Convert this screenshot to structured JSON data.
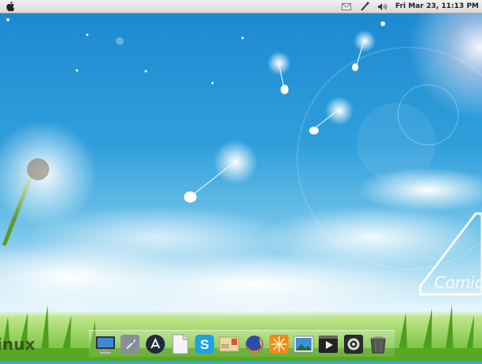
{
  "menubar": {
    "app_icon": "apple-logo-icon",
    "tray_icons": [
      "mail-icon",
      "network-icon",
      "volume-icon"
    ],
    "clock": "Fri Mar 23, 11:13 PM"
  },
  "desktop": {
    "partial_label_left": "inux",
    "partial_label_right": "Comic"
  },
  "dock": {
    "items": [
      {
        "name": "system-settings",
        "icon": "monitor-icon"
      },
      {
        "name": "launcher",
        "icon": "rocket-icon"
      },
      {
        "name": "app-store",
        "icon": "app-store-icon"
      },
      {
        "name": "text-editor",
        "icon": "document-icon"
      },
      {
        "name": "skype",
        "icon": "skype-icon"
      },
      {
        "name": "mail",
        "icon": "mail-stamp-icon"
      },
      {
        "name": "firefox",
        "icon": "firefox-icon"
      },
      {
        "name": "photo-app",
        "icon": "starburst-icon"
      },
      {
        "name": "image-viewer",
        "icon": "picture-icon"
      },
      {
        "name": "media-player",
        "icon": "play-icon"
      },
      {
        "name": "tools",
        "icon": "tools-icon"
      },
      {
        "name": "trash",
        "icon": "trash-icon"
      }
    ]
  },
  "colors": {
    "sky_top": "#1b87cf",
    "grass": "#64b52c",
    "menubar": "#e6e6e6"
  }
}
